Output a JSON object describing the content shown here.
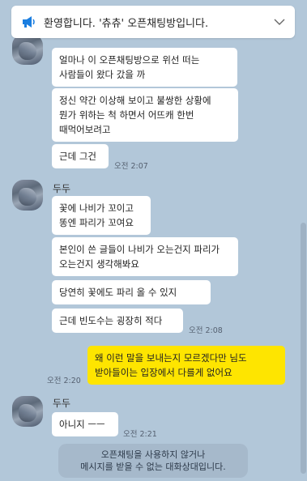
{
  "notice": {
    "text": "환영합니다. '츄츄' 오픈채팅방입니다.",
    "icon": "megaphone-icon",
    "toggle_icon": "chevron-down-icon"
  },
  "groups": [
    {
      "sender": "",
      "messages": [
        "얼마나 이 오픈채팅방으로 위선 떠는 사람들이 왔다 갔을 까",
        "정신 약간 이상해 보이고 불쌍한 상황에 뭔가 위하는 척 하면서 어뜨캐 한번 때먹어보려고",
        "근데 그건"
      ],
      "time": "오전 2:07"
    },
    {
      "sender": "두두",
      "messages": [
        "꽃에 나비가 꼬이고 똥엔 파리가 꼬여요",
        "본인이 쓴 글들이 나비가 오는건지 파리가 오는건지 생각해봐요",
        "당연히 꽃에도 파리 올 수 있지",
        "근데 빈도수는 굉장히 적다"
      ],
      "time": "오전 2:08"
    },
    {
      "sender": "me",
      "messages": [
        "왜 이런 말을 보내는지 모르겠다만 님도 받아들이는 입장에서 다를게 없어요"
      ],
      "time": "오전 2:20"
    },
    {
      "sender": "두두",
      "messages": [
        "아니지 ㅡㅡ"
      ],
      "time": "오전 2:21"
    }
  ],
  "system_notice": {
    "line1": "오픈채팅을 사용하지 않거나",
    "line2": "메시지를 받을 수 없는 대화상대입니다."
  },
  "colors": {
    "background": "#b2c7d9",
    "my_bubble": "#fee500",
    "other_bubble": "#ffffff",
    "megaphone": "#1b7ee0"
  }
}
